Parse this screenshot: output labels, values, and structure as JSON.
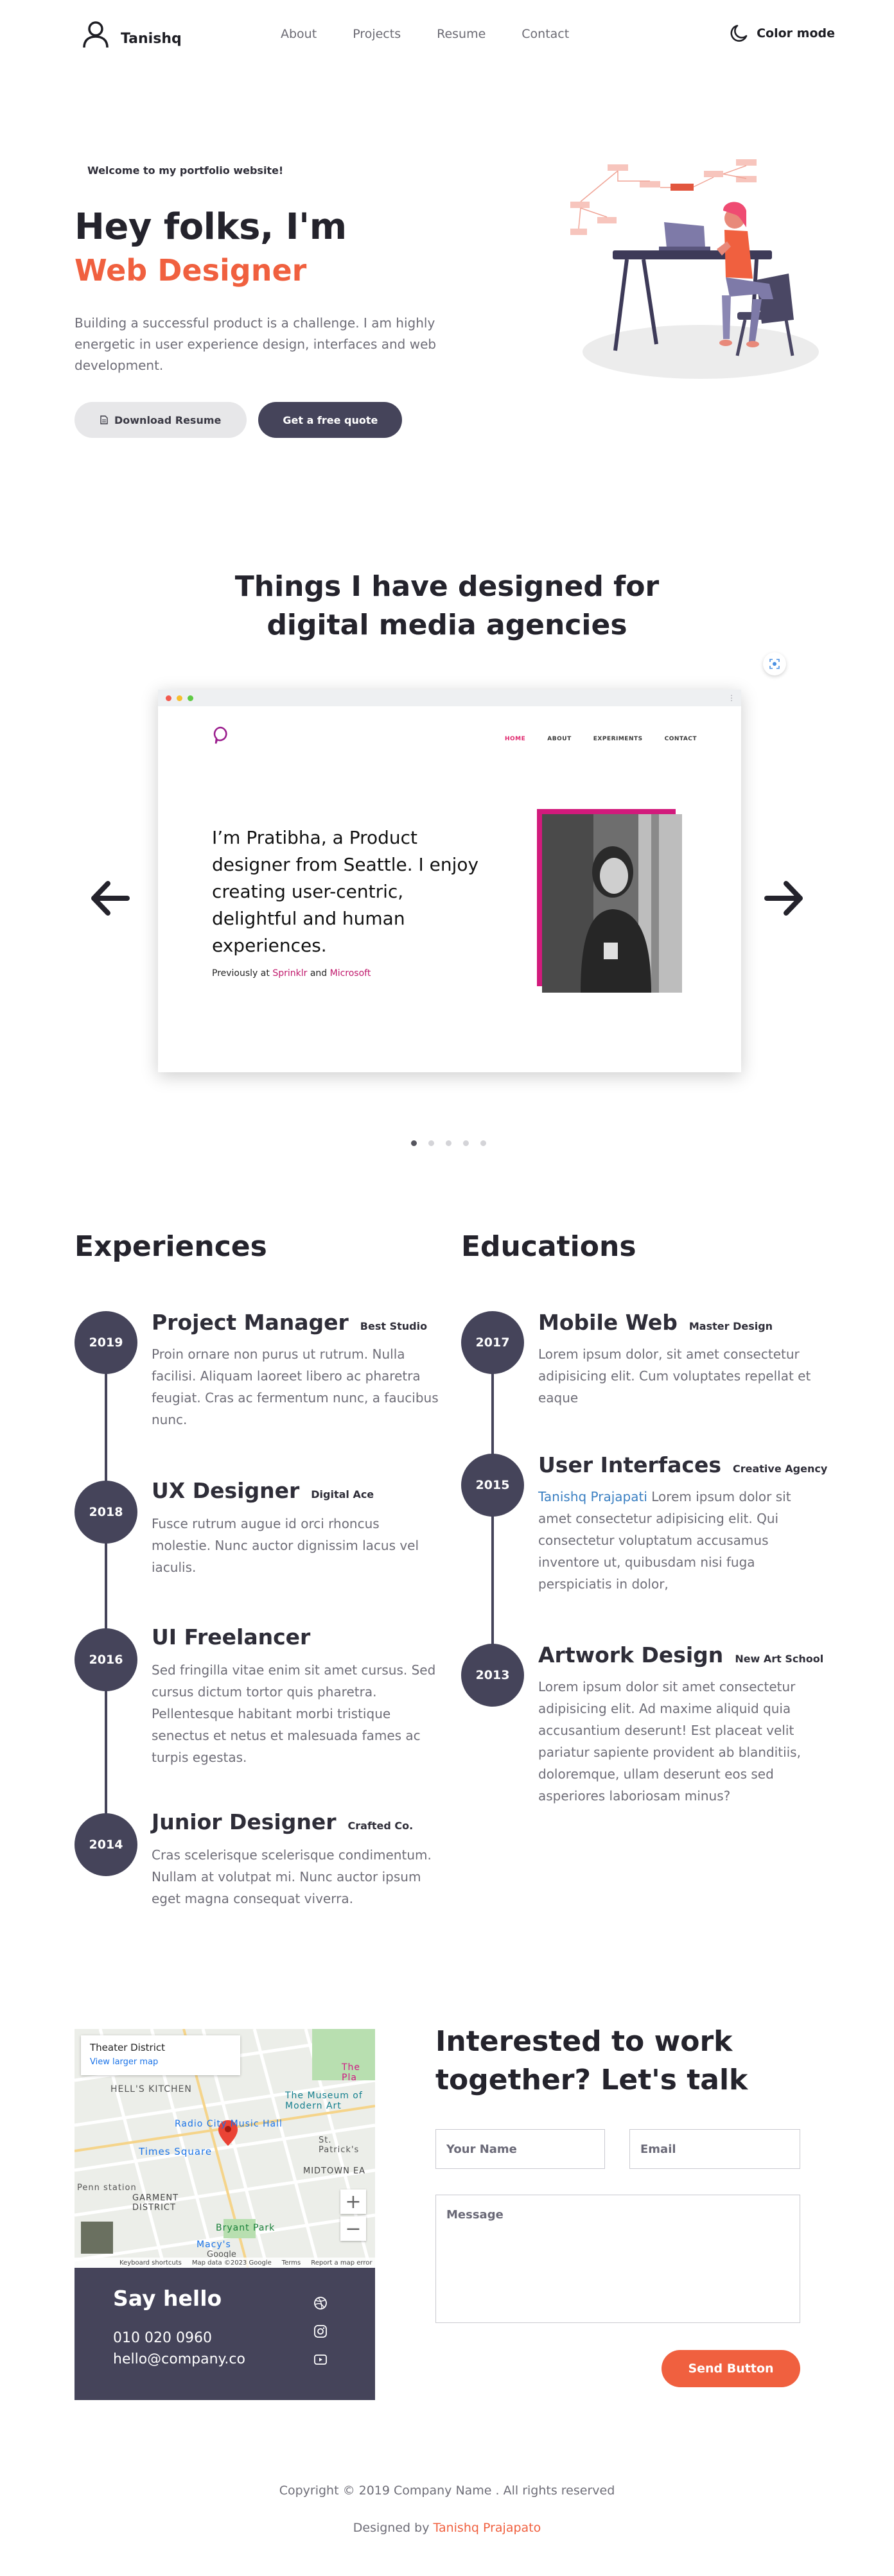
{
  "nav": {
    "logo_text": "Tanishq",
    "links": [
      "About",
      "Projects",
      "Resume",
      "Contact"
    ],
    "color_mode_label": "Color mode"
  },
  "hero": {
    "welcome": "Welcome to my portfolio website!",
    "greeting": "Hey folks, I'm",
    "role": "Web Designer",
    "description": "Building a successful product is a challenge. I am highly energetic in user experience design, interfaces and web development.",
    "download_label": "Download Resume",
    "quote_label": "Get a free quote"
  },
  "projects": {
    "title_line1": "Things I have designed for",
    "title_line2": "digital media agencies",
    "slide": {
      "menu": [
        "HOME",
        "ABOUT",
        "EXPERIMENTS",
        "CONTACT"
      ],
      "headline": "I’m Pratibha, a Product designer from Seattle. I enjoy creating user-centric, delightful and human experiences.",
      "prev_prefix": "Previously at",
      "prev_company1": "Sprinklr",
      "prev_and": "and",
      "prev_company2": "Microsoft"
    },
    "slide_count": 5,
    "active_slide": 1
  },
  "experiences": {
    "title": "Experiences",
    "items": [
      {
        "year": "2019",
        "role": "Project Manager",
        "company": "Best Studio",
        "desc": "Proin ornare non purus ut rutrum. Nulla facilisi. Aliquam laoreet libero ac pharetra feugiat. Cras ac fermentum nunc, a faucibus nunc."
      },
      {
        "year": "2018",
        "role": "UX Designer",
        "company": "Digital Ace",
        "desc": "Fusce rutrum augue id orci rhoncus molestie. Nunc auctor dignissim lacus vel iaculis."
      },
      {
        "year": "2016",
        "role": "UI Freelancer",
        "company": "",
        "desc": "Sed fringilla vitae enim sit amet cursus. Sed cursus dictum tortor quis pharetra. Pellentesque habitant morbi tristique senectus et netus et malesuada fames ac turpis egestas."
      },
      {
        "year": "2014",
        "role": "Junior Designer",
        "company": "Crafted Co.",
        "desc": "Cras scelerisque scelerisque condimentum. Nullam at volutpat mi. Nunc auctor ipsum eget magna consequat viverra."
      }
    ]
  },
  "educations": {
    "title": "Educations",
    "items": [
      {
        "year": "2017",
        "role": "Mobile Web",
        "company": "Master Design",
        "desc": "Lorem ipsum dolor, sit amet consectetur adipisicing elit. Cum voluptates repellat et eaque"
      },
      {
        "year": "2015",
        "role": "User Interfaces",
        "company": "Creative Agency",
        "link": "Tanishq Prajapati",
        "desc": " Lorem ipsum dolor sit amet consectetur adipisicing elit. Qui consectetur voluptatum accusamus inventore ut, quibusdam nisi fuga perspiciatis in dolor,"
      },
      {
        "year": "2013",
        "role": "Artwork Design",
        "company": "New Art School",
        "desc": "Lorem ipsum dolor sit amet consectetur adipisicing elit. Ad maxime aliquid quia accusantium deserunt! Est placeat velit pariatur sapiente provident ab blanditiis, doloremque, ullam deserunt eos sed asperiores laboriosam minus?"
      }
    ]
  },
  "contact": {
    "map": {
      "place": "Theater District",
      "larger_map": "View larger map",
      "labels": [
        "HELL'S KITCHEN",
        "Radio City Music Hall",
        "The Museum of Modern Art",
        "Times Square",
        "St. Patrick's",
        "MIDTOWN EA",
        "GARMENT DISTRICT",
        "Penn station",
        "Bryant Park",
        "Macy's",
        "The Pla"
      ],
      "footer": [
        "Keyboard shortcuts",
        "Map data ©2023 Google",
        "Terms",
        "Report a map error"
      ],
      "brand": "Google"
    },
    "say_hello": "Say hello",
    "phone": "010 020 0960",
    "email": "hello@company.co",
    "title_line1": "Interested to work",
    "title_line2": "together? Let's talk",
    "name_placeholder": "Your Name",
    "email_placeholder": "Email",
    "message_placeholder": "Message",
    "send_label": "Send Button"
  },
  "footer": {
    "copyright": "Copyright © 2019 Company Name . All rights reserved",
    "designed_prefix": "Designed by",
    "designer": "Tanishq Prajapato"
  },
  "colors": {
    "accent": "#f0603f",
    "dark": "#45445a",
    "pink": "#d21a7c"
  }
}
